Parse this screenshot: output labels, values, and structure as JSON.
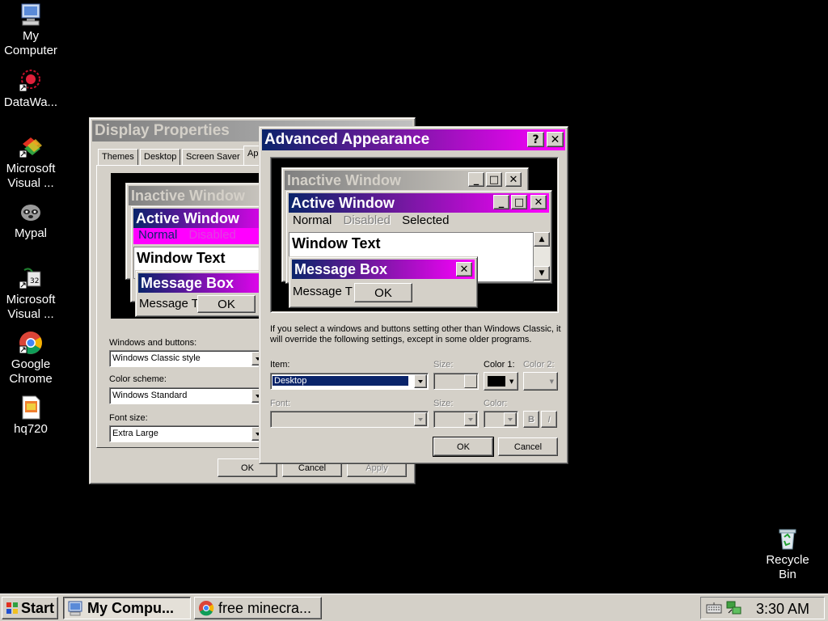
{
  "desktop": {
    "icons": [
      {
        "label": "My Computer",
        "icon": "computer-icon"
      },
      {
        "label": "DataWa...",
        "icon": "datawatch-icon"
      },
      {
        "label": "Microsoft Visual ...",
        "icon": "visual-studio-icon"
      },
      {
        "label": "Mypal",
        "icon": "mypal-icon"
      },
      {
        "label": "Microsoft Visual ...",
        "icon": "visual-studio-setup-icon"
      },
      {
        "label": "Google Chrome",
        "icon": "chrome-icon"
      },
      {
        "label": "hq720",
        "icon": "image-file-icon"
      },
      {
        "label": "Recycle Bin",
        "icon": "recycle-bin-icon"
      }
    ]
  },
  "display_properties": {
    "title": "Display Properties",
    "tabs": [
      "Themes",
      "Desktop",
      "Screen Saver",
      "Ap"
    ],
    "preview": {
      "inactive": "Inactive Window",
      "active": "Active Window",
      "normal": "Normal",
      "disabled": "Disabled",
      "window_text": "Window Text",
      "message_box": "Message Box",
      "message_text": "Message T",
      "ok": "OK"
    },
    "windows_buttons_label": "Windows and buttons:",
    "windows_buttons_value": "Windows Classic style",
    "color_scheme_label": "Color scheme:",
    "color_scheme_value": "Windows Standard",
    "font_size_label": "Font size:",
    "font_size_value": "Extra Large",
    "ok": "OK",
    "cancel": "Cancel",
    "apply": "Apply"
  },
  "advanced": {
    "title": "Advanced Appearance",
    "help": "?",
    "close": "✕",
    "preview": {
      "inactive": "Inactive Window",
      "active": "Active Window",
      "normal": "Normal",
      "disabled": "Disabled",
      "selected": "Selected",
      "window_text": "Window Text",
      "message_box": "Message Box",
      "message_text": "Message T",
      "ok": "OK"
    },
    "note": "If you select a windows and buttons setting other than Windows Classic, it will override the following settings, except in some older programs.",
    "item_label": "Item:",
    "item_value": "Desktop",
    "size_label": "Size:",
    "color1_label": "Color 1:",
    "color2_label": "Color 2:",
    "font_label": "Font:",
    "size2_label": "Size:",
    "color_label": "Color:",
    "bold": "B",
    "italic": "I",
    "ok": "OK",
    "cancel": "Cancel"
  },
  "taskbar": {
    "start": "Start",
    "tasks": [
      "My Compu...",
      "free minecra..."
    ],
    "clock": "3:30 AM"
  },
  "colors": {
    "desktop": "#000000",
    "face": "#d4d0c8",
    "active_title_start": "#0a246a",
    "active_title_end": "#ff00ff",
    "inactive_title_start": "#808080",
    "inactive_title_end": "#d4d0c8",
    "selection": "#0a246a"
  }
}
